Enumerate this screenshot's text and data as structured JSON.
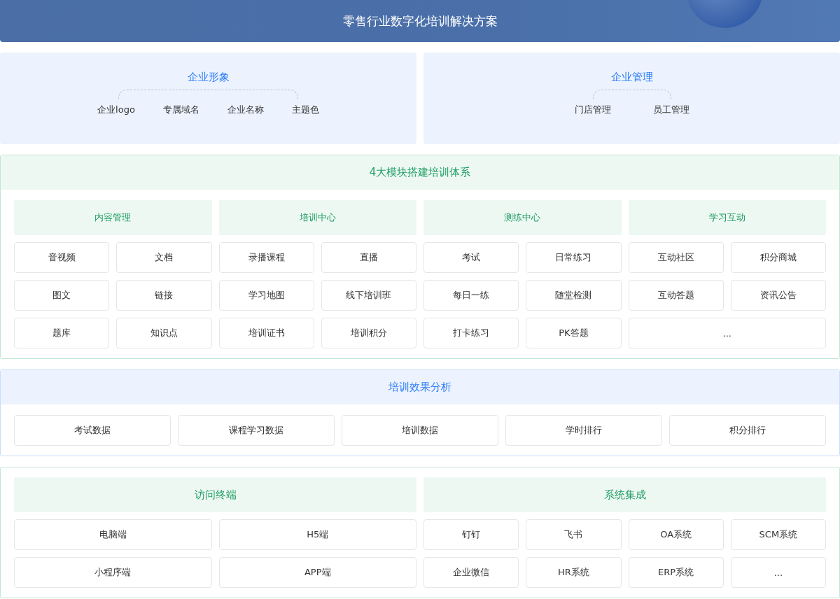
{
  "banner": {
    "title": "零售行业数字化培训解决方案"
  },
  "overview": [
    {
      "title": "企业形象",
      "items": [
        "企业logo",
        "专属域名",
        "企业名称",
        "主题色"
      ]
    },
    {
      "title": "企业管理",
      "items": [
        "门店管理",
        "员工管理"
      ]
    }
  ],
  "modules": {
    "title": "4大模块搭建培训体系",
    "columns": [
      {
        "title": "内容管理",
        "items": [
          {
            "label": "音视频",
            "wide": false
          },
          {
            "label": "文档",
            "wide": false
          },
          {
            "label": "图文",
            "wide": false
          },
          {
            "label": "链接",
            "wide": false
          },
          {
            "label": "题库",
            "wide": false
          },
          {
            "label": "知识点",
            "wide": false
          }
        ]
      },
      {
        "title": "培训中心",
        "items": [
          {
            "label": "录播课程",
            "wide": false
          },
          {
            "label": "直播",
            "wide": false
          },
          {
            "label": "学习地图",
            "wide": false
          },
          {
            "label": "线下培训班",
            "wide": false
          },
          {
            "label": "培训证书",
            "wide": false
          },
          {
            "label": "培训积分",
            "wide": false
          }
        ]
      },
      {
        "title": "测练中心",
        "items": [
          {
            "label": "考试",
            "wide": false
          },
          {
            "label": "日常练习",
            "wide": false
          },
          {
            "label": "每日一练",
            "wide": false
          },
          {
            "label": "随堂检测",
            "wide": false
          },
          {
            "label": "打卡练习",
            "wide": false
          },
          {
            "label": "PK答题",
            "wide": false
          }
        ]
      },
      {
        "title": "学习互动",
        "items": [
          {
            "label": "互动社区",
            "wide": false
          },
          {
            "label": "积分商城",
            "wide": false
          },
          {
            "label": "互动答题",
            "wide": false
          },
          {
            "label": "资讯公告",
            "wide": false
          },
          {
            "label": "...",
            "wide": true
          }
        ]
      }
    ]
  },
  "analysis": {
    "title": "培训效果分析",
    "items": [
      "考试数据",
      "课程学习数据",
      "培训数据",
      "学时排行",
      "积分排行"
    ]
  },
  "access": {
    "groups": [
      {
        "title": "访问终端",
        "items": [
          "电脑端",
          "H5端",
          "小程序端",
          "APP端"
        ]
      },
      {
        "title": "系统集成",
        "items": [
          "钉钉",
          "飞书",
          "OA系统",
          "SCM系统",
          "企业微信",
          "HR系统",
          "ERP系统",
          "..."
        ]
      }
    ]
  }
}
